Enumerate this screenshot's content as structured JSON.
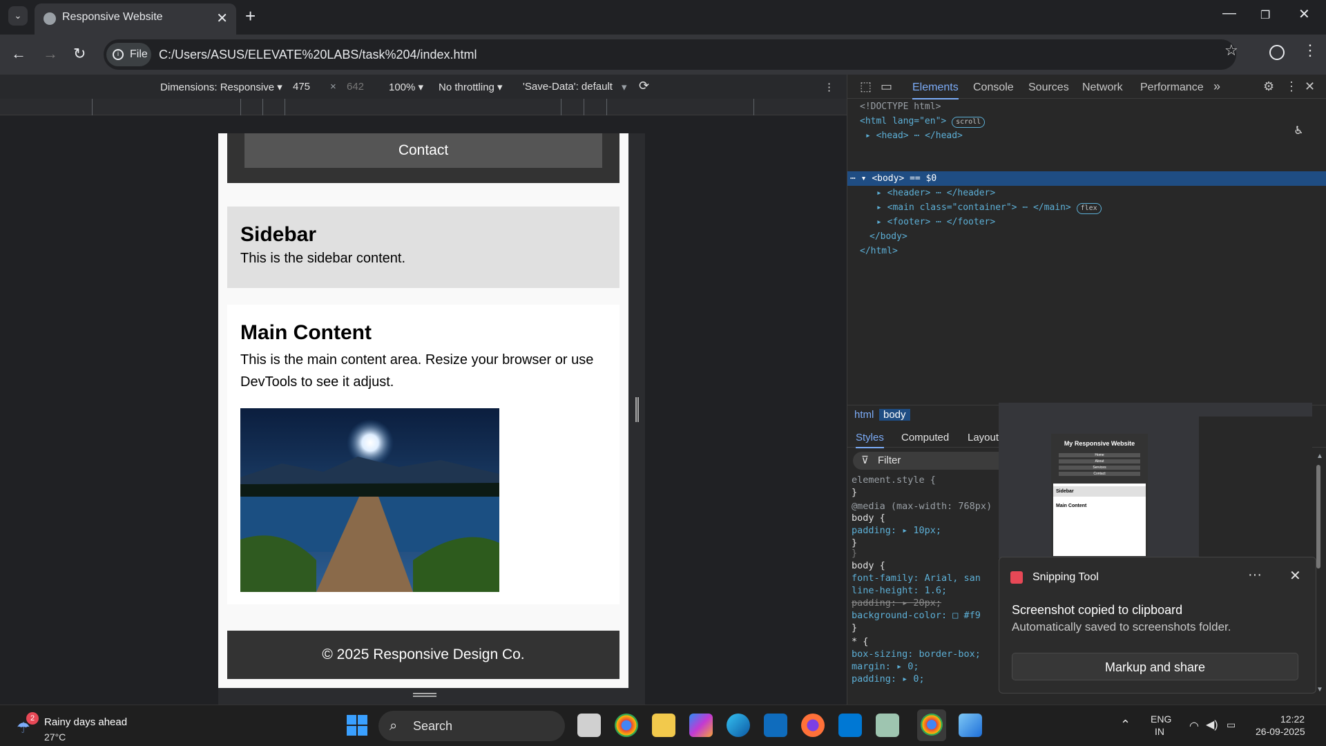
{
  "browser": {
    "tab_title": "Responsive Website",
    "tab_close": "✕",
    "new_tab": "+",
    "url_chip": "File",
    "url": "C:/Users/ASUS/ELEVATE%20LABS/task%204/index.html"
  },
  "device_toolbar": {
    "dimensions": "Dimensions: Responsive ▾",
    "width": "475",
    "times": "×",
    "height": "642",
    "zoom": "100% ▾",
    "throttling": "No throttling ▾",
    "save_data": "'Save-Data': default",
    "more": "⋮"
  },
  "page": {
    "nav_contact": "Contact",
    "sidebar_title": "Sidebar",
    "sidebar_text": "This is the sidebar content.",
    "main_title": "Main Content",
    "main_text": "This is the main content area. Resize your browser or use DevTools to see it adjust.",
    "footer_text": "© 2025 Responsive Design Co."
  },
  "devtools": {
    "tabs": [
      "Elements",
      "Console",
      "Sources",
      "Network",
      "Performance"
    ],
    "more_tabs": "»",
    "dom": {
      "doctype": "<!DOCTYPE html>",
      "html_open": "<html lang=\"en\">",
      "scroll_badge": "scroll",
      "head": "<head> ⋯ </head>",
      "body_open": "<body> == $0",
      "header": "<header> ⋯ </header>",
      "main": "<main class=\"container\"> ⋯ </main>",
      "flex_badge": "flex",
      "footer": "<footer> ⋯ </footer>",
      "body_close": "</body>",
      "html_close": "</html>"
    },
    "breadcrumbs": [
      "html",
      "body"
    ],
    "style_tabs": [
      "Styles",
      "Computed",
      "Layout"
    ],
    "filter_placeholder": "Filter",
    "css_lines": [
      "element.style {",
      "}",
      "@media (max-width: 768px)",
      " body {",
      "    padding: ▸ 10px;",
      " }",
      "}",
      "body {",
      "  font-family: Arial, san",
      "  line-height: 1.6;",
      "  padding: ▸ 20px;",
      "  background-color: □ #f9",
      "}",
      "* {",
      "  box-sizing: border-box;",
      "  margin: ▸ 0;",
      "  padding: ▸ 0;"
    ]
  },
  "thumbnail": {
    "heading": "My Responsive Website",
    "items": [
      "Home",
      "About",
      "Services",
      "Contact"
    ],
    "sidebar": "Sidebar",
    "main": "Main Content"
  },
  "snipping": {
    "app": "Snipping Tool",
    "more": "···",
    "close": "✕",
    "message": "Screenshot copied to clipboard",
    "sub": "Automatically saved to screenshots folder.",
    "action": "Markup and share"
  },
  "taskbar": {
    "weather_badge": "2",
    "weather_title": "Rainy days ahead",
    "weather_temp": "27°C",
    "search": "Search",
    "lang1": "ENG",
    "lang2": "IN",
    "time": "12:22",
    "date": "26-09-2025"
  },
  "colors": {
    "accent": "#5db0d7",
    "selection": "#1f4d83",
    "page_dark": "#333333",
    "nav_button": "#555555"
  }
}
